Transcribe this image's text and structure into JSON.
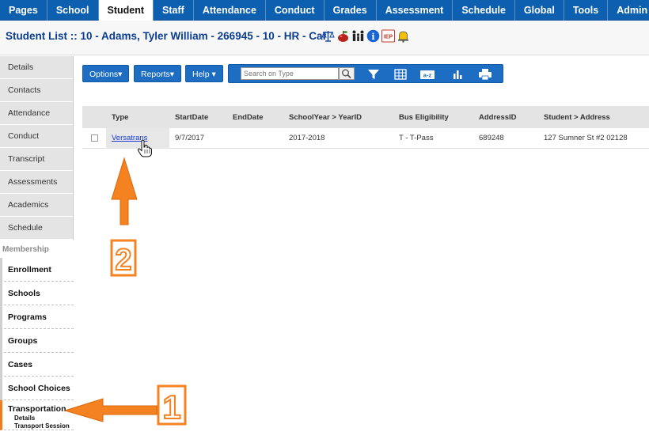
{
  "top_tabs": [
    {
      "label": "Pages",
      "active": false
    },
    {
      "label": "School",
      "active": false
    },
    {
      "label": "Student",
      "active": true
    },
    {
      "label": "Staff",
      "active": false
    },
    {
      "label": "Attendance",
      "active": false
    },
    {
      "label": "Conduct",
      "active": false
    },
    {
      "label": "Grades",
      "active": false
    },
    {
      "label": "Assessment",
      "active": false
    },
    {
      "label": "Schedule",
      "active": false
    },
    {
      "label": "Global",
      "active": false
    },
    {
      "label": "Tools",
      "active": false
    },
    {
      "label": "Admin",
      "active": false
    }
  ],
  "header": {
    "title": "Student List :: 10 - Adams, Tyler William - 266945 - 10 - HR - Caf",
    "flag_icons": [
      "scales-icon",
      "apple-icon",
      "family-icon",
      "info-icon",
      "iep-icon",
      "bell-icon"
    ],
    "iep_label": "IEP",
    "info_label": "i"
  },
  "sidebar": {
    "items": [
      "Details",
      "Contacts",
      "Attendance",
      "Conduct",
      "Transcript",
      "Assessments",
      "Academics",
      "Schedule"
    ],
    "section_label": "Membership",
    "subitems": [
      {
        "label": "Enrollment",
        "active": false
      },
      {
        "label": "Schools",
        "active": false
      },
      {
        "label": "Programs",
        "active": false
      },
      {
        "label": "Groups",
        "active": false
      },
      {
        "label": "Cases",
        "active": false
      },
      {
        "label": "School Choices",
        "active": false
      },
      {
        "label": "Transportation",
        "active": true,
        "children": [
          "Details",
          "Transport Session"
        ]
      }
    ]
  },
  "toolbar": {
    "options_label": "Options▾",
    "reports_label": "Reports▾",
    "help_label": "Help ▾",
    "search_placeholder": "Search on Type",
    "az_label": "a-z"
  },
  "grid": {
    "columns": [
      "Type",
      "StartDate",
      "EndDate",
      "SchoolYear > YearID",
      "Bus Eligibility",
      "AddressID",
      "Student > Address"
    ],
    "rows": [
      {
        "type": "Versatrans",
        "start_date": "9/7/2017",
        "end_date": "",
        "school_year": "2017-2018",
        "bus_eligibility": "T - T-Pass",
        "address_id": "689248",
        "address": "127 Sumner St #2 02128"
      }
    ]
  },
  "annotations": {
    "label_1": "1",
    "label_2": "2",
    "accent_color": "#f58220"
  },
  "colors": {
    "nav_blue": "#0d60b0",
    "button_blue": "#1d6ec2",
    "title_blue": "#0b3d91",
    "active_border": "#f07c1e"
  }
}
